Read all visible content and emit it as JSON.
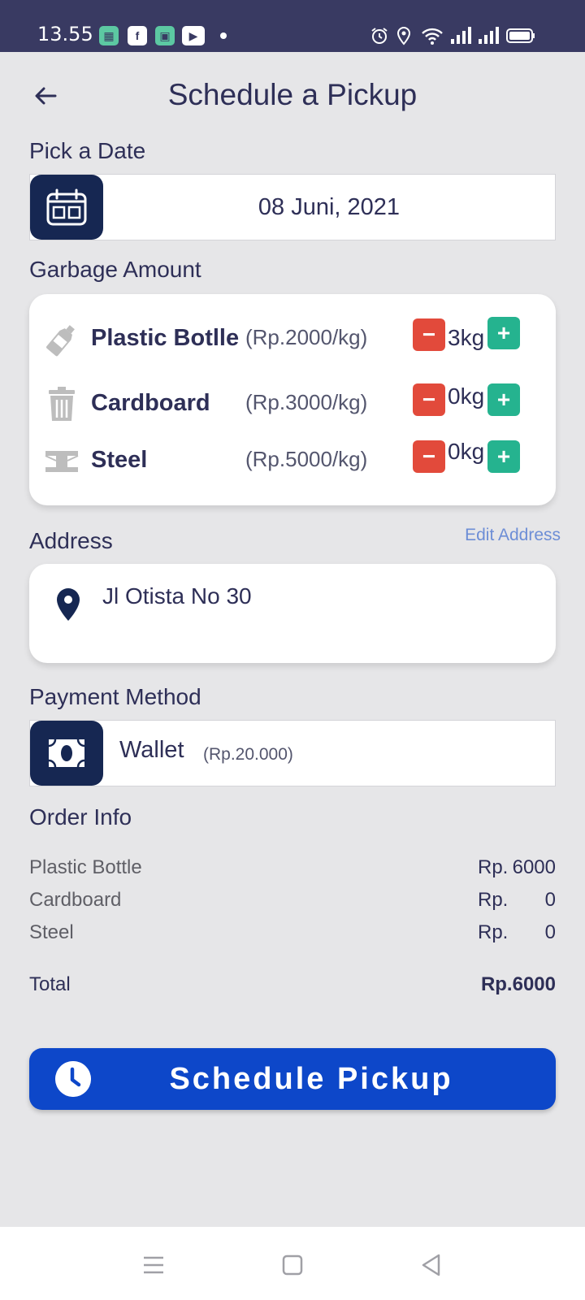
{
  "status_bar": {
    "time": "13.55"
  },
  "header": {
    "title": "Schedule a Pickup"
  },
  "date_section": {
    "label": "Pick a Date",
    "value": "08 Juni, 2021"
  },
  "garbage_section": {
    "label": "Garbage Amount",
    "items": [
      {
        "name": "Plastic Botlle",
        "price": "(Rp.2000/kg)",
        "quantity": "3kg",
        "minus": "−",
        "plus": "+"
      },
      {
        "name": "Cardboard",
        "price": "(Rp.3000/kg)",
        "quantity": "0kg",
        "minus": "−",
        "plus": "+"
      },
      {
        "name": "Steel",
        "price": "(Rp.5000/kg)",
        "quantity": "0kg",
        "minus": "−",
        "plus": "+"
      }
    ]
  },
  "address_section": {
    "label": "Address",
    "edit_label": "Edit Address",
    "value": "Jl Otista No 30"
  },
  "payment_section": {
    "label": "Payment Method",
    "method": "Wallet",
    "balance": "(Rp.20.000)"
  },
  "order_info": {
    "label": "Order Info",
    "rows": [
      {
        "name": "Plastic Bottle",
        "currency": "Rp.",
        "amount": "6000"
      },
      {
        "name": "Cardboard",
        "currency": "Rp.",
        "amount": "0"
      },
      {
        "name": "Steel",
        "currency": "Rp.",
        "amount": "0"
      }
    ],
    "total_label": "Total",
    "total_value": "Rp.6000"
  },
  "cta": {
    "label": "Schedule Pickup"
  },
  "colors": {
    "status_bar": "#393a62",
    "primary_dark": "#162752",
    "accent_blue": "#0d47c9",
    "minus_red": "#e24a3b",
    "plus_green": "#25b38f",
    "text_dark": "#2e2f57",
    "link": "#6d8ed6"
  },
  "icons": {
    "back": "arrow-left-icon",
    "date": "calendar-icon",
    "plastic": "bottle-icon",
    "cardboard": "trash-bin-icon",
    "steel": "steel-beam-icon",
    "address": "location-pin-icon",
    "payment": "cash-icon",
    "cta": "clock-icon"
  }
}
